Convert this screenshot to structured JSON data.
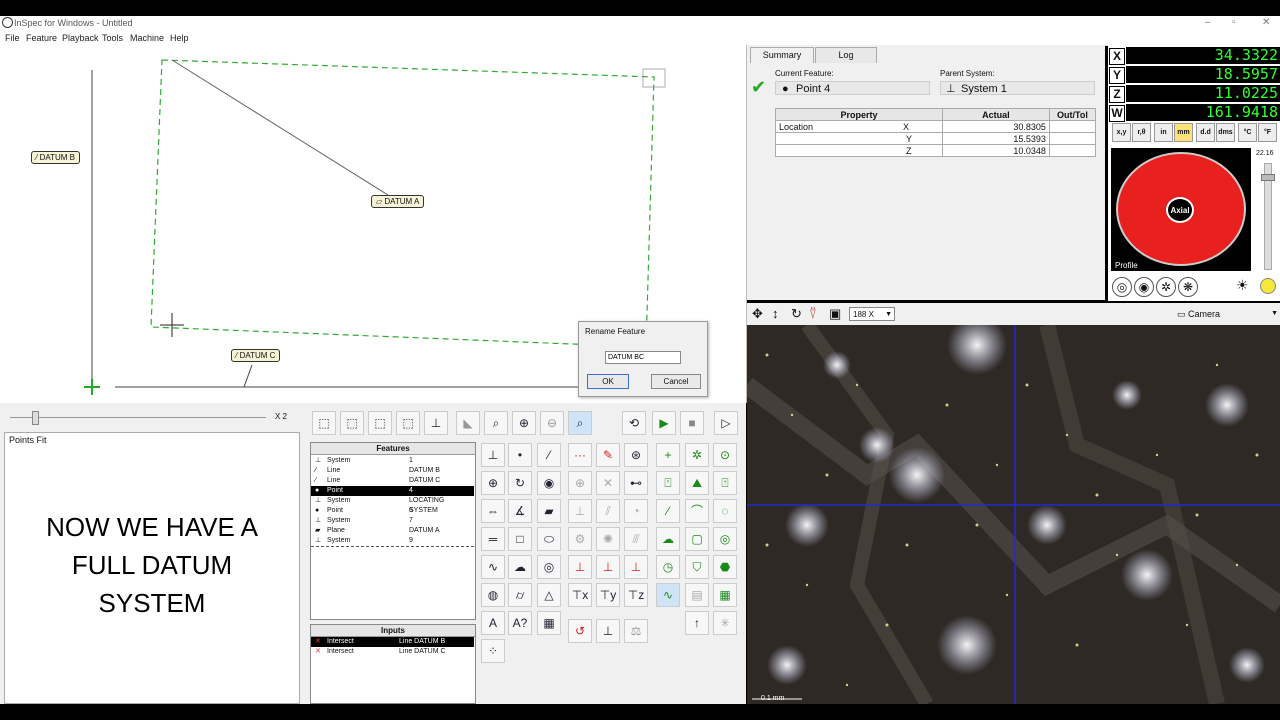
{
  "window": {
    "title": "InSpec for Windows - Untitled"
  },
  "menu": [
    "File",
    "Feature",
    "Playback",
    "Tools",
    "Machine",
    "Help"
  ],
  "canvas": {
    "tags": {
      "datum_b": "DATUM B",
      "datum_a": "DATUM A",
      "datum_c": "DATUM C"
    },
    "zoom_label": "X 2"
  },
  "summary": {
    "tabs": [
      "Summary",
      "Log"
    ],
    "current_feature_label": "Current Feature:",
    "current_feature": "Point 4",
    "parent_system_label": "Parent System:",
    "parent_system": "System 1",
    "table": {
      "headers": [
        "Property",
        "Actual",
        "Out/Tol"
      ],
      "rows": [
        {
          "prop": "Location",
          "axis": "X",
          "actual": "30.8305",
          "tol": ""
        },
        {
          "prop": "",
          "axis": "Y",
          "actual": "15.5393",
          "tol": ""
        },
        {
          "prop": "",
          "axis": "Z",
          "actual": "10.0348",
          "tol": ""
        }
      ]
    }
  },
  "dro": {
    "rows": [
      {
        "axis": "X",
        "value": "34.3322"
      },
      {
        "axis": "Y",
        "value": "18.5957"
      },
      {
        "axis": "Z",
        "value": "11.0225"
      },
      {
        "axis": "W",
        "value": "161.9418"
      }
    ],
    "unit_buttons": [
      "x,y",
      "r,θ",
      "in",
      "mm",
      "d.d",
      "dms",
      "°C",
      "°F"
    ],
    "light_label": "Axial",
    "profile_label": "Profile",
    "slider_value": "22.16",
    "colors": {
      "digits": "#33ff33",
      "ring": "#e8201e"
    }
  },
  "camera": {
    "zoom": "188 X",
    "source": "Camera",
    "scale_label": "0.1 mm"
  },
  "points_fit": {
    "title": "Points Fit",
    "overlay": [
      "NOW WE HAVE A",
      "FULL DATUM",
      "SYSTEM"
    ]
  },
  "features": {
    "header": "Features",
    "rows": [
      {
        "icon": "system",
        "type": "System",
        "name": "1"
      },
      {
        "icon": "line",
        "type": "Line",
        "name": "DATUM B"
      },
      {
        "icon": "line",
        "type": "Line",
        "name": "DATUM C"
      },
      {
        "icon": "point",
        "type": "Point",
        "name": "4"
      },
      {
        "icon": "system",
        "type": "System",
        "name": "LOCATING SYSTEM"
      },
      {
        "icon": "point",
        "type": "Point",
        "name": "6"
      },
      {
        "icon": "system",
        "type": "System",
        "name": "7"
      },
      {
        "icon": "plane",
        "type": "Plane",
        "name": "DATUM A"
      },
      {
        "icon": "system",
        "type": "System",
        "name": "9"
      }
    ]
  },
  "inputs": {
    "header": "Inputs",
    "rows": [
      {
        "type": "Intersect",
        "source": "Line DATUM B"
      },
      {
        "type": "Intersect",
        "source": "Line DATUM C"
      }
    ]
  },
  "dialog": {
    "title": "Rename Feature",
    "value": "DATUM BC",
    "ok": "OK",
    "cancel": "Cancel"
  }
}
